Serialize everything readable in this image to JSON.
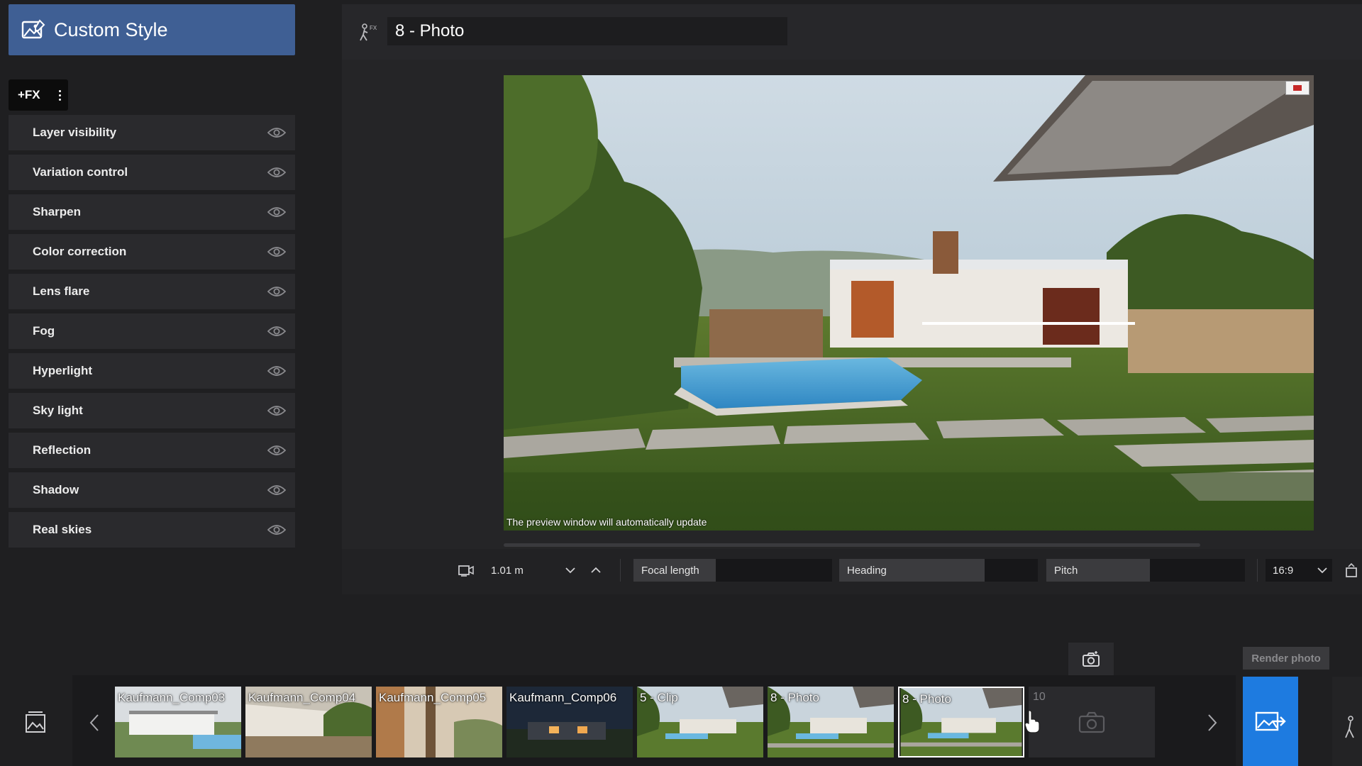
{
  "header": {
    "title": "Custom Style",
    "icon": "style-image-icon"
  },
  "fx_button": {
    "label": "+FX",
    "menu_icon": "kebab-menu-icon"
  },
  "effects": [
    {
      "label": "Layer visibility"
    },
    {
      "label": "Variation control"
    },
    {
      "label": "Sharpen"
    },
    {
      "label": "Color correction"
    },
    {
      "label": "Lens flare"
    },
    {
      "label": "Fog"
    },
    {
      "label": "Hyperlight"
    },
    {
      "label": "Sky light"
    },
    {
      "label": "Reflection"
    },
    {
      "label": "Shadow"
    },
    {
      "label": "Real skies"
    }
  ],
  "main": {
    "title": "8 - Photo",
    "title_icon": "fx-walker-icon",
    "preview_note": "The preview window will automatically update"
  },
  "camera_bar": {
    "height_value": "1.01 m",
    "focal_label": "Focal length",
    "heading_label": "Heading",
    "pitch_label": "Pitch",
    "aspect": "16:9"
  },
  "bottom": {
    "render_label": "Render photo",
    "empty_slot": "10"
  },
  "thumbnails": [
    {
      "label": "Kaufmann_Comp03"
    },
    {
      "label": "Kaufmann_Comp04"
    },
    {
      "label": "Kaufmann_Comp05"
    },
    {
      "label": "Kaufmann_Comp06"
    },
    {
      "label": "5 - Clip"
    },
    {
      "label": "8 - Photo"
    },
    {
      "label": "8 - Photo"
    }
  ],
  "colors": {
    "accent_header": "#3f5f94",
    "accent_render": "#1e7be0",
    "panel": "#2a2a2d",
    "background": "#1f1f21"
  }
}
